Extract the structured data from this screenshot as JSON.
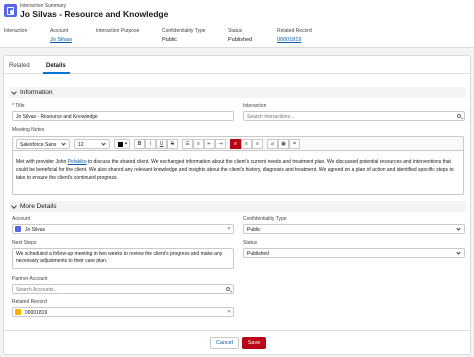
{
  "header": {
    "object_type": "Interaction Summary",
    "record_title": "Jo Silvas - Resource and Knowledge",
    "highlights": [
      {
        "label": "Interaction",
        "value": ""
      },
      {
        "label": "Account",
        "value": "Jo Silvas"
      },
      {
        "label": "Interaction Purpose",
        "value": ""
      },
      {
        "label": "Confidentiality Type",
        "value": "Public"
      },
      {
        "label": "Status",
        "value": "Published"
      },
      {
        "label": "Related Record",
        "value": "00001819"
      }
    ]
  },
  "tabs": [
    {
      "label": "Related",
      "active": false
    },
    {
      "label": "Details",
      "active": true
    }
  ],
  "information": {
    "section_title": "Information",
    "title_label": "Title",
    "title_value": "Jo Silvas -  Resource and Knowledge",
    "interaction_label": "Interaction",
    "interaction_placeholder": "Search Interactions...",
    "meeting_notes_label": "Meeting Notes",
    "toolbar": {
      "font": "Salesforce Sans",
      "size": "12",
      "buttons": [
        "B",
        "I",
        "U",
        "S",
        "☰",
        "≡",
        "⇤",
        "⇥",
        "≡",
        "≡",
        "≡",
        "⌀",
        "▣",
        "⌗"
      ]
    },
    "notes_pre": "Met with provider John ",
    "notes_name": "Pelakiko",
    "notes_post": " to discuss the shared client. We exchanged information about the client's current needs and treatment plan. We discussed potential resources and interventions that could be beneficial for the client. We also shared any relevant knowledge and insights about the client's history, diagnosis and treatment. We agreed on a plan of action and identified specific steps to take to ensure the client's continued progress."
  },
  "more_details": {
    "section_title": "More Details",
    "account_label": "Account",
    "account_value": "Jo Silvas",
    "confidentiality_label": "Confidentiality Type",
    "confidentiality_value": "Public",
    "next_steps_label": "Next Steps",
    "next_steps_value": "We scheduled a follow-up meeting in two weeks to review the client's progress and make any necessary adjustments to their care plan.",
    "status_label": "Status",
    "status_value": "Published",
    "partner_account_label": "Partner Account",
    "partner_account_placeholder": "Search Accounts...",
    "related_record_label": "Related Record",
    "related_record_value": "00001819"
  },
  "footer": {
    "cancel_label": "Cancel",
    "save_label": "Save"
  },
  "colors": {
    "brand": "#0176d3",
    "save": "#ba0517",
    "object_icon": "#5867e8",
    "account_icon": "#5867e8",
    "record_icon": "#f4b400"
  }
}
